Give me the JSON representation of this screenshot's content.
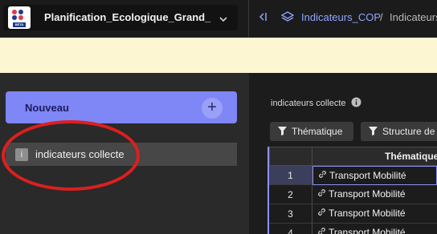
{
  "topbar": {
    "workspace_title": "Planification_Ecologique_Grand_...",
    "logo_badge": "BETA",
    "breadcrumb": {
      "parent": "Indicateurs_COP",
      "separator": "/",
      "current": "Indicateurs"
    }
  },
  "sidebar": {
    "new_button_label": "Nouveau",
    "plus_label": "+",
    "items": [
      {
        "icon_letter": "i",
        "label": "indicateurs collecte"
      }
    ]
  },
  "main": {
    "view_title": "indicateurs collecte",
    "filters": [
      {
        "label": "Thématique"
      },
      {
        "label": "Structure de"
      }
    ],
    "table": {
      "columns": [
        "",
        "Thématique"
      ],
      "rows": [
        {
          "num": "1",
          "theme": "Transport Mobilité"
        },
        {
          "num": "2",
          "theme": "Transport Mobilité"
        },
        {
          "num": "3",
          "theme": "Transport Mobilité"
        },
        {
          "num": "4",
          "theme": "Transport Mobilité"
        }
      ]
    }
  },
  "colors": {
    "accent": "#7f86f5",
    "link": "#8fa6ff",
    "banner": "#fdf6d3",
    "annotation": "#dd1f1f"
  },
  "icons": {
    "chevron": "chevron-down-icon",
    "collapse": "sidebar-collapse-icon",
    "layers": "layers-icon",
    "info": "info-icon",
    "filter": "filter-icon",
    "link": "link-icon"
  }
}
